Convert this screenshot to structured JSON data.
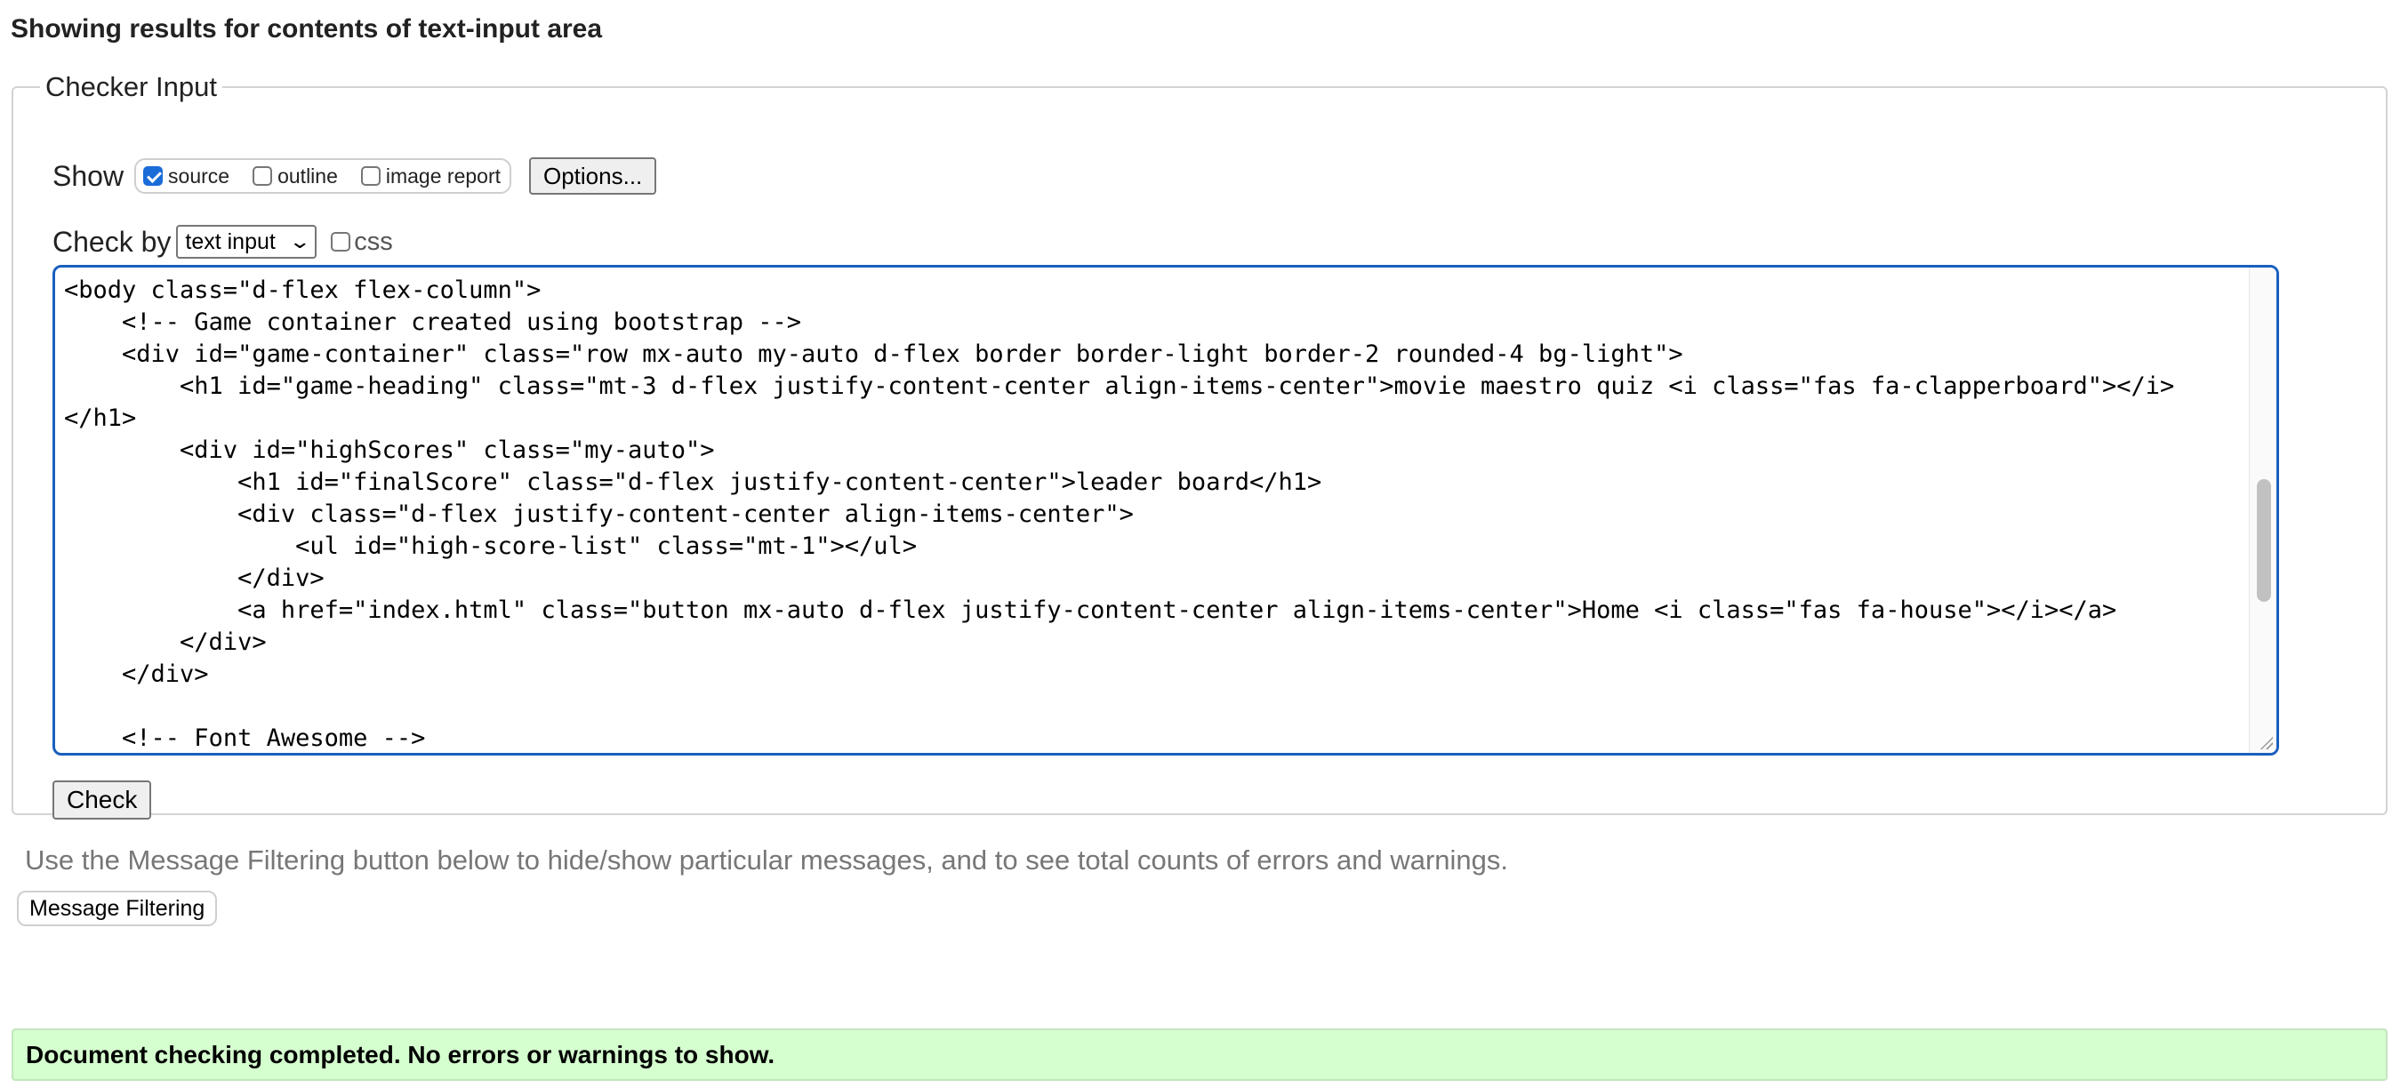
{
  "page": {
    "heading": "Showing results for contents of text-input area"
  },
  "checker": {
    "legend": "Checker Input",
    "show_label": "Show",
    "show_options": [
      {
        "label": "source",
        "checked": true
      },
      {
        "label": "outline",
        "checked": false
      },
      {
        "label": "image report",
        "checked": false
      }
    ],
    "options_button": "Options...",
    "checkby_label": "Check by",
    "checkby_select": "text input",
    "css_label": "css",
    "css_checked": false,
    "source_text": "<body class=\"d-flex flex-column\">\n    <!-- Game container created using bootstrap -->\n    <div id=\"game-container\" class=\"row mx-auto my-auto d-flex border border-light border-2 rounded-4 bg-light\">\n        <h1 id=\"game-heading\" class=\"mt-3 d-flex justify-content-center align-items-center\">movie maestro quiz <i class=\"fas fa-clapperboard\"></i>\n</h1>\n        <div id=\"highScores\" class=\"my-auto\">\n            <h1 id=\"finalScore\" class=\"d-flex justify-content-center\">leader board</h1>\n            <div class=\"d-flex justify-content-center align-items-center\">\n                <ul id=\"high-score-list\" class=\"mt-1\"></ul>\n            </div>\n            <a href=\"index.html\" class=\"button mx-auto d-flex justify-content-center align-items-center\">Home <i class=\"fas fa-house\"></i></a>\n        </div>\n    </div>\n\n    <!-- Font Awesome -->",
    "check_button": "Check"
  },
  "filtering": {
    "note": "Use the Message Filtering button below to hide/show particular messages, and to see total counts of errors and warnings.",
    "button": "Message Filtering"
  },
  "result": {
    "message": "Document checking completed. No errors or warnings to show.",
    "bg_color": "#d5ffcf"
  },
  "colors": {
    "focus_border": "#1a5fbf",
    "checkbox_checked": "#1a6cd8"
  }
}
